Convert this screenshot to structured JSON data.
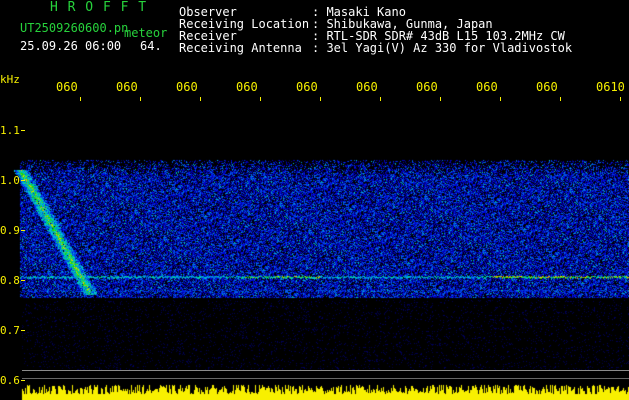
{
  "header": {
    "title": "H R O F F T",
    "filename": "UT2509260600.pn",
    "meteor_label": "meteor",
    "date_time": "25.09.26 06:00",
    "count": "64.",
    "info_lines": [
      {
        "key": "Observer",
        "value": ": Masaki Kano"
      },
      {
        "key": "Receiving Location",
        "value": ": Shibukawa, Gunma, Japan"
      },
      {
        "key": "Receiver",
        "value": ": RTL-SDR SDR# 43dB L15 103.2MHz CW"
      },
      {
        "key": "Receiving Antenna",
        "value": ": 3el Yagi(V) Az 330 for Vladivostok"
      }
    ]
  },
  "axis": {
    "unit": "kHz",
    "time_labels": [
      "060",
      "060",
      "060",
      "060",
      "060",
      "060",
      "060",
      "060",
      "060",
      "0610"
    ],
    "freq_labels": [
      "1.1",
      "1.0",
      "0.9",
      "0.8",
      "0.7",
      "0.6"
    ]
  },
  "colors": {
    "title_green": "#27d23c",
    "text_white": "#ffffff",
    "axis_yellow": "#f7f000",
    "noise_blue": "#1a3bd8"
  }
}
